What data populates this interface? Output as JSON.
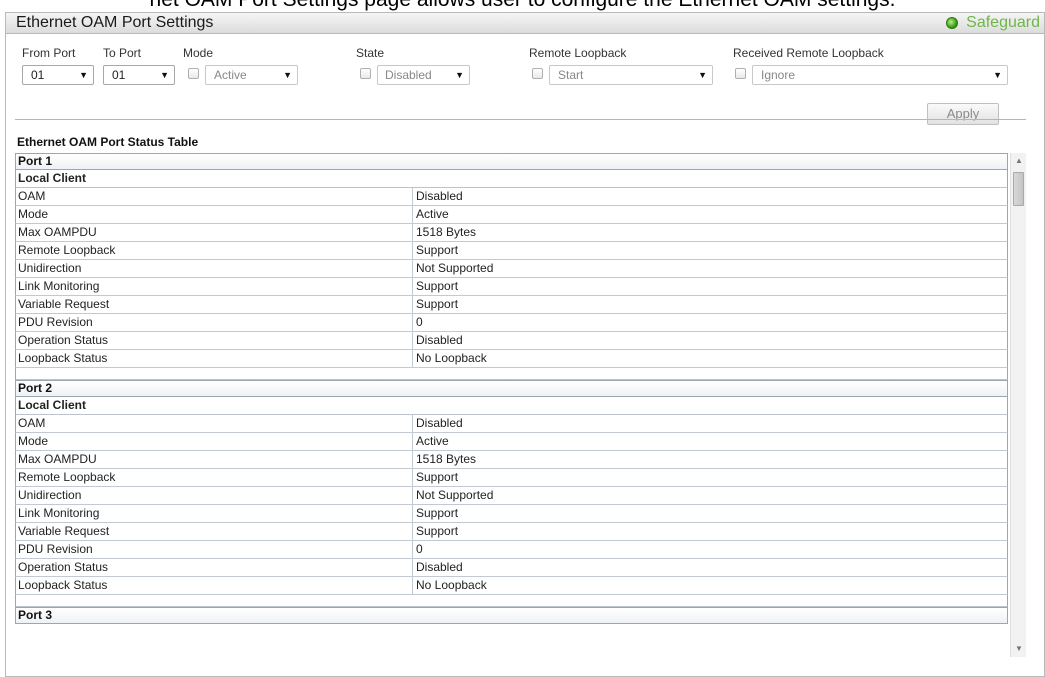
{
  "caption": "net OAM Port Settings page allows user to configure the Ethernet OAM settings.",
  "header": {
    "title": "Ethernet OAM Port Settings",
    "safeguard_label": "Safeguard",
    "safeguard_status_color": "#3aa018"
  },
  "form": {
    "from_port_label": "From Port",
    "to_port_label": "To Port",
    "mode_label": "Mode",
    "state_label": "State",
    "remote_loopback_label": "Remote Loopback",
    "received_remote_loopback_label": "Received Remote Loopback",
    "from_port_value": "01",
    "to_port_value": "01",
    "mode_value": "Active",
    "state_value": "Disabled",
    "remote_loopback_value": "Start",
    "received_remote_loopback_value": "Ignore",
    "apply_label": "Apply"
  },
  "table": {
    "title": "Ethernet OAM Port Status Table",
    "ports": [
      {
        "name": "Port 1",
        "section": "Local Client",
        "rows": [
          {
            "label": "OAM",
            "value": "Disabled"
          },
          {
            "label": "Mode",
            "value": "Active"
          },
          {
            "label": "Max OAMPDU",
            "value": "1518 Bytes"
          },
          {
            "label": "Remote Loopback",
            "value": "Support"
          },
          {
            "label": "Unidirection",
            "value": "Not Supported"
          },
          {
            "label": "Link Monitoring",
            "value": "Support"
          },
          {
            "label": "Variable Request",
            "value": "Support"
          },
          {
            "label": "PDU Revision",
            "value": "0"
          },
          {
            "label": "Operation Status",
            "value": "Disabled"
          },
          {
            "label": "Loopback Status",
            "value": "No Loopback"
          }
        ]
      },
      {
        "name": "Port 2",
        "section": "Local Client",
        "rows": [
          {
            "label": "OAM",
            "value": "Disabled"
          },
          {
            "label": "Mode",
            "value": "Active"
          },
          {
            "label": "Max OAMPDU",
            "value": "1518 Bytes"
          },
          {
            "label": "Remote Loopback",
            "value": "Support"
          },
          {
            "label": "Unidirection",
            "value": "Not Supported"
          },
          {
            "label": "Link Monitoring",
            "value": "Support"
          },
          {
            "label": "Variable Request",
            "value": "Support"
          },
          {
            "label": "PDU Revision",
            "value": "0"
          },
          {
            "label": "Operation Status",
            "value": "Disabled"
          },
          {
            "label": "Loopback Status",
            "value": "No Loopback"
          }
        ]
      },
      {
        "name": "Port 3"
      }
    ]
  },
  "icons": {
    "dropdown_arrow": "triangle-down-icon",
    "scroll_up": "triangle-up-icon",
    "scroll_down": "triangle-down-icon",
    "safeguard_status": "green-status-dot-icon"
  }
}
